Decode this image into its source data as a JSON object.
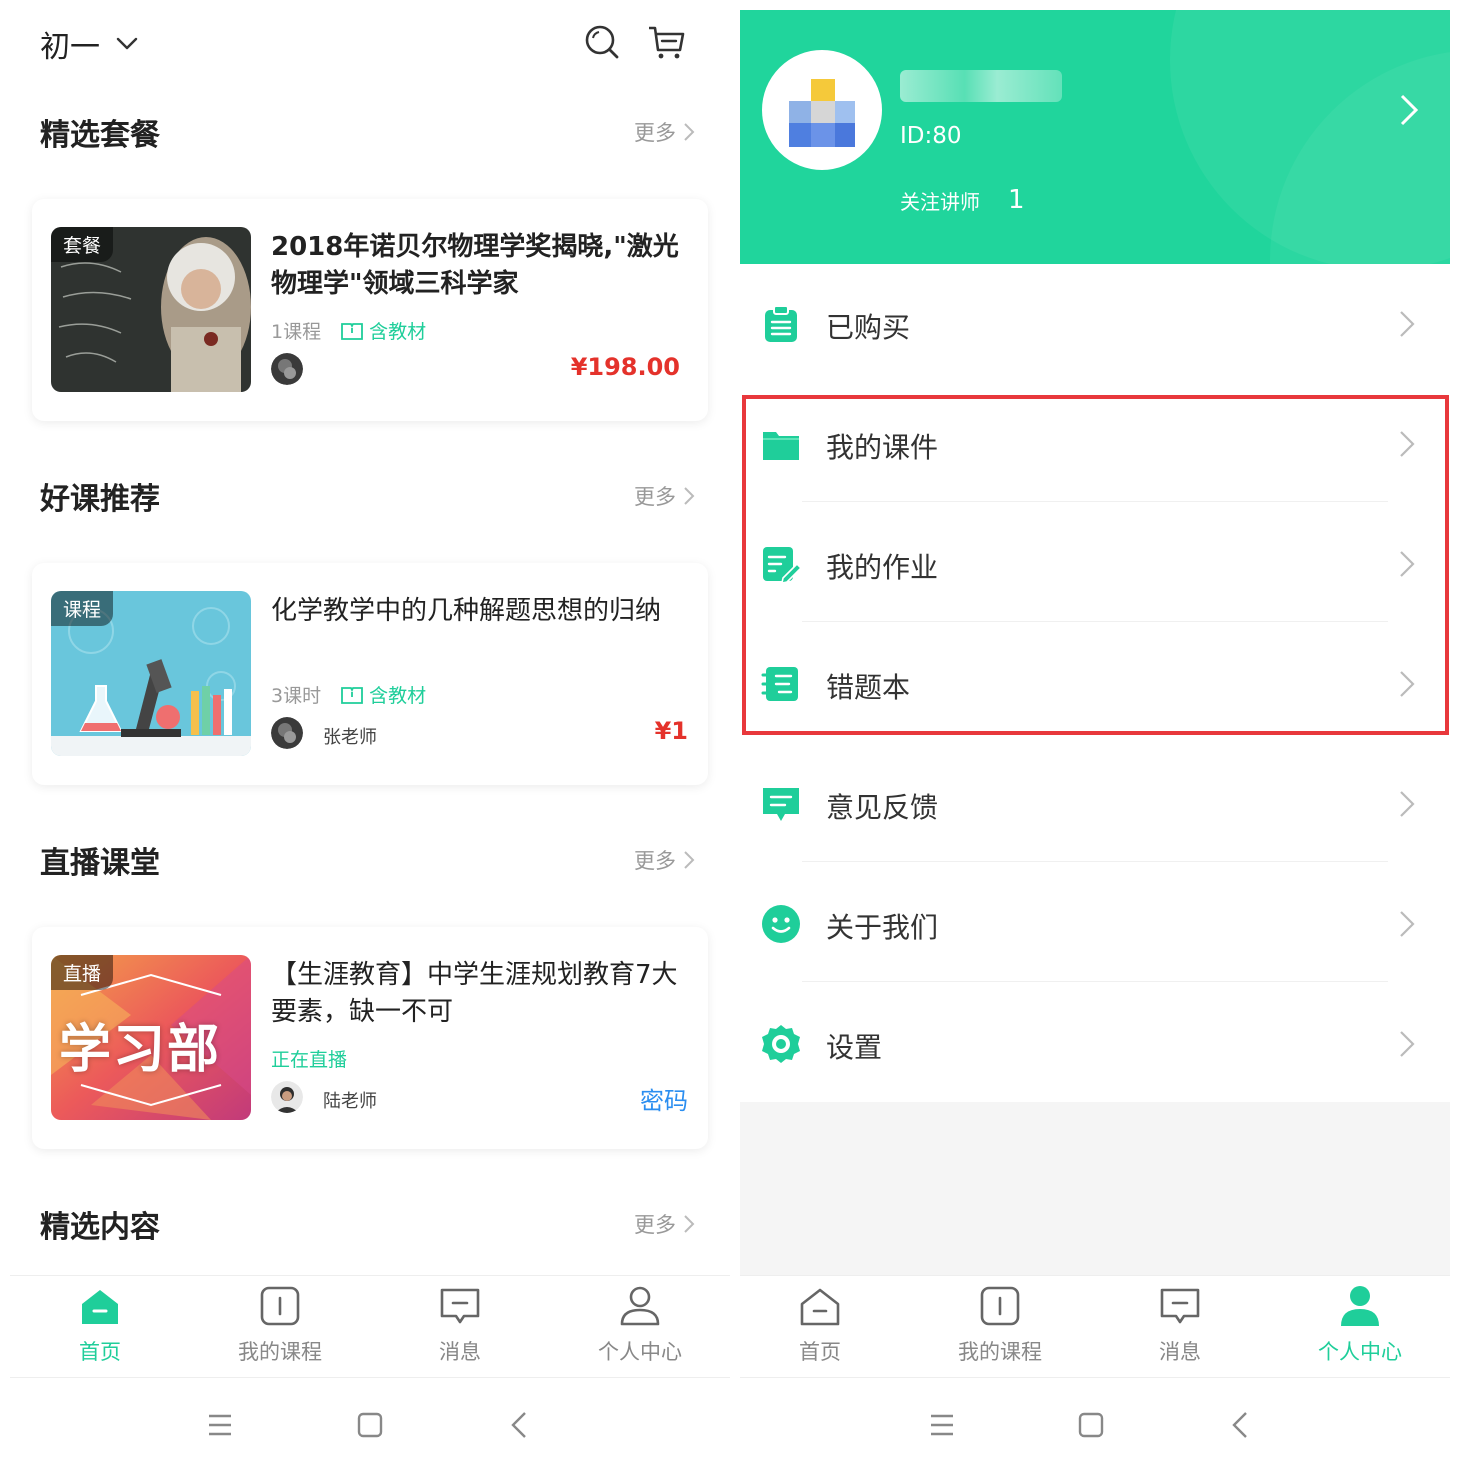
{
  "home": {
    "grade_selector": "初一",
    "sections": [
      {
        "title": "精选套餐",
        "more": "更多"
      },
      {
        "title": "好课推荐",
        "more": "更多"
      },
      {
        "title": "直播课堂",
        "more": "更多"
      },
      {
        "title": "精选内容",
        "more": "更多"
      }
    ],
    "cards": [
      {
        "tag": "套餐",
        "title": "2018年诺贝尔物理学奖揭晓,\"激光物理学\"领域三科学家",
        "meta": "1课程",
        "material": "含教材",
        "teacher": "",
        "price": "¥198.00"
      },
      {
        "tag": "课程",
        "title": "化学教学中的几种解题思想的归纳",
        "meta": "3课时",
        "material": "含教材",
        "teacher": "张老师",
        "price": "¥1"
      },
      {
        "tag": "直播",
        "title": "【生涯教育】中学生涯规划教育7大要素，缺一不可",
        "status": "正在直播",
        "teacher": "陆老师",
        "action": "密码",
        "thumb_text": "学习部"
      }
    ],
    "tabs": [
      {
        "label": "首页",
        "icon": "home-icon",
        "active": true
      },
      {
        "label": "我的课程",
        "icon": "course-icon",
        "active": false
      },
      {
        "label": "消息",
        "icon": "message-icon",
        "active": false
      },
      {
        "label": "个人中心",
        "icon": "user-icon",
        "active": false
      }
    ]
  },
  "profile": {
    "id": "ID:80",
    "follow_label": "关注讲师",
    "follow_count": "1",
    "menu": [
      {
        "label": "已购买",
        "icon": "clipboard-icon"
      },
      {
        "label": "我的课件",
        "icon": "folder-icon"
      },
      {
        "label": "我的作业",
        "icon": "homework-icon"
      },
      {
        "label": "错题本",
        "icon": "notebook-icon"
      },
      {
        "label": "意见反馈",
        "icon": "feedback-icon"
      },
      {
        "label": "关于我们",
        "icon": "smile-icon"
      },
      {
        "label": "设置",
        "icon": "settings-icon"
      }
    ],
    "tabs": [
      {
        "label": "首页",
        "icon": "home-icon",
        "active": false
      },
      {
        "label": "我的课程",
        "icon": "course-icon",
        "active": false
      },
      {
        "label": "消息",
        "icon": "message-icon",
        "active": false
      },
      {
        "label": "个人中心",
        "icon": "user-icon",
        "active": true
      }
    ]
  },
  "colors": {
    "accent": "#1fce9a",
    "price": "#e4322b",
    "link": "#2b8ef0",
    "highlight": "#e8383c"
  }
}
